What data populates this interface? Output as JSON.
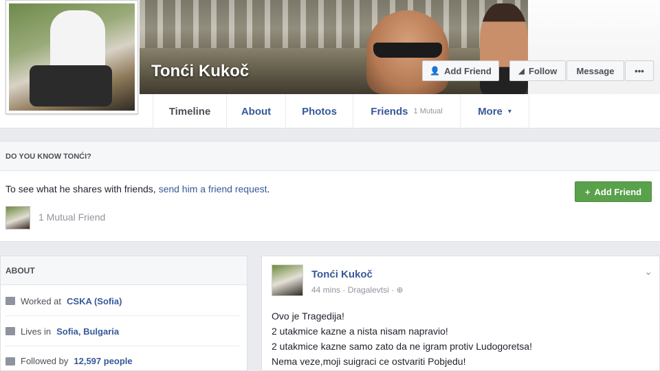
{
  "profile": {
    "name": "Tonći Kukoč",
    "actions": {
      "add_friend": "Add Friend",
      "follow": "Follow",
      "message": "Message",
      "more": "•••"
    }
  },
  "tabs": [
    {
      "label": "Timeline"
    },
    {
      "label": "About"
    },
    {
      "label": "Photos"
    },
    {
      "label": "Friends",
      "sub": "1 Mutual"
    },
    {
      "label": "More",
      "caret": "▾"
    }
  ],
  "know_panel": {
    "title": "DO YOU KNOW TONĆI?",
    "text": "To see what he shares with friends, ",
    "link": "send him a friend request",
    "period": ".",
    "mutual": "1 Mutual Friend",
    "add_friend": "Add Friend",
    "add_icon": "+"
  },
  "about": {
    "title": "ABOUT",
    "rows": [
      {
        "prefix": "Worked at ",
        "value": "CSKA (Sofia)"
      },
      {
        "prefix": "Lives in ",
        "value": "Sofia, Bulgaria"
      },
      {
        "prefix": "Followed by ",
        "value": "12,597 people"
      }
    ]
  },
  "post": {
    "author": "Tonći Kukoč",
    "time": "44 mins",
    "sep": "·",
    "location": "Dragalevtsi",
    "globe": "⊕",
    "chevron": "⌄",
    "lines": [
      "Ovo je Tragedija!",
      "2 utakmice kazne a nista nisam napravio!",
      "2 utakmice kazne samo zato da ne igram protiv Ludogoretsa!",
      "Nema veze,moji suigraci ce ostvariti Pobjedu!"
    ]
  }
}
